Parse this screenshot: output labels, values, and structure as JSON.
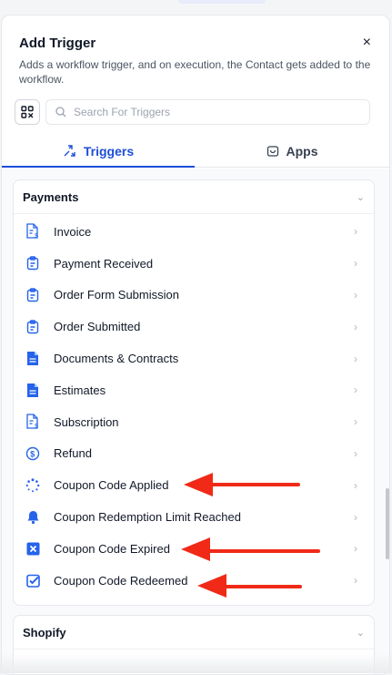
{
  "header": {
    "title": "Add Trigger",
    "close_glyph": "×",
    "subtitle": "Adds a workflow trigger, and on execution, the Contact gets added to the workflow."
  },
  "search": {
    "placeholder": "Search For Triggers",
    "value": ""
  },
  "tabs": [
    {
      "label": "Triggers",
      "icon": "triggers-icon",
      "active": true
    },
    {
      "label": "Apps",
      "icon": "apps-icon",
      "active": false
    }
  ],
  "sections": {
    "payments": {
      "title": "Payments",
      "items": [
        {
          "label": "Invoice",
          "icon": "invoice-icon"
        },
        {
          "label": "Payment Received",
          "icon": "clipboard-icon"
        },
        {
          "label": "Order Form Submission",
          "icon": "clipboard-icon"
        },
        {
          "label": "Order Submitted",
          "icon": "clipboard-icon"
        },
        {
          "label": "Documents & Contracts",
          "icon": "document-icon"
        },
        {
          "label": "Estimates",
          "icon": "document-icon"
        },
        {
          "label": "Subscription",
          "icon": "invoice-icon"
        },
        {
          "label": "Refund",
          "icon": "refund-icon"
        },
        {
          "label": "Coupon Code Applied",
          "icon": "loading-dots-icon"
        },
        {
          "label": "Coupon Redemption Limit Reached",
          "icon": "bell-icon"
        },
        {
          "label": "Coupon Code Expired",
          "icon": "x-square-icon"
        },
        {
          "label": "Coupon Code Redeemed",
          "icon": "check-square-icon"
        }
      ]
    },
    "shopify": {
      "title": "Shopify"
    }
  },
  "colors": {
    "accent": "#1d4ed8",
    "icon_blue": "#2563eb",
    "arrow_red": "#f02a17"
  }
}
